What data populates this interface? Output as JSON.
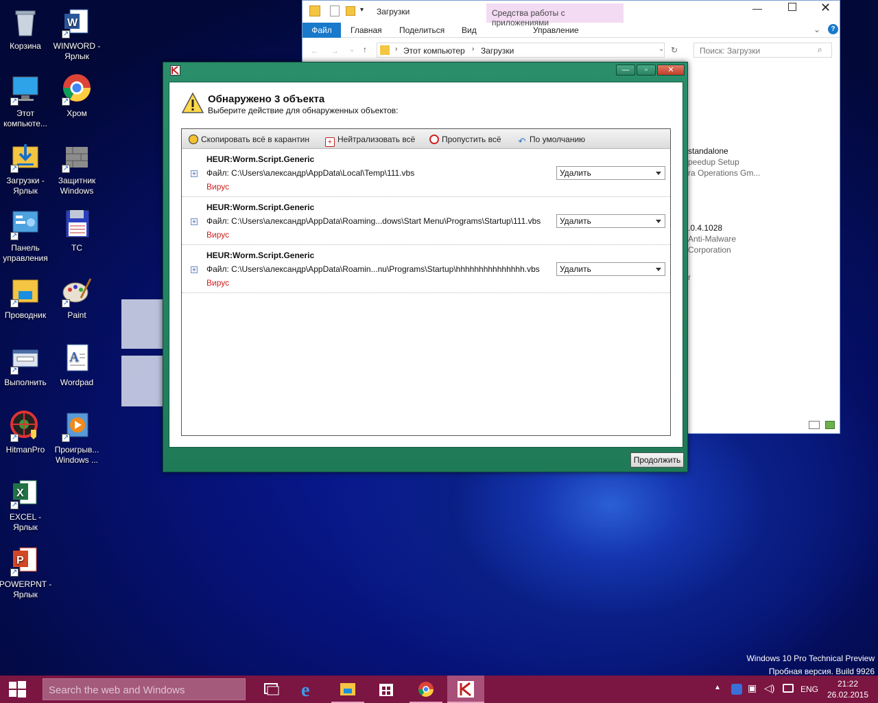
{
  "desktop": {
    "icons": [
      {
        "label": "Корзина"
      },
      {
        "label": "WINWORD - Ярлык"
      },
      {
        "label": "Этот компьюте..."
      },
      {
        "label": "Хром"
      },
      {
        "label": "Загрузки - Ярлык"
      },
      {
        "label": "Защитник Windows"
      },
      {
        "label": "Панель управления"
      },
      {
        "label": "TC"
      },
      {
        "label": "Проводник"
      },
      {
        "label": "Paint"
      },
      {
        "label": "Выполнить"
      },
      {
        "label": "Wordpad"
      },
      {
        "label": "HitmanPro"
      },
      {
        "label": "Проигрыв... Windows ..."
      },
      {
        "label": "EXCEL - Ярлык"
      },
      {
        "label": "POWERPNT - Ярлык"
      }
    ],
    "watermark": {
      "line1": "Windows 10 Pro Technical Preview",
      "line2": "Пробная версия. Build 9926"
    }
  },
  "explorer": {
    "title": "Загрузки",
    "context_tab": "Средства работы с приложениями",
    "tabs": {
      "file": "Файл",
      "home": "Главная",
      "share": "Поделиться",
      "view": "Вид",
      "manage": "Управление"
    },
    "breadcrumb": [
      "Этот компьютер",
      "Загрузки"
    ],
    "search_placeholder": "Поиск: Загрузки",
    "visible_fragments": [
      "standalone",
      "peedup Setup",
      "ra Operations Gm...",
      ".0.4.1028",
      "Anti-Malware",
      "Corporation",
      "r"
    ]
  },
  "kav": {
    "heading": "Обнаружено 3 объекта",
    "subheading": "Выберите действие для обнаруженных объектов:",
    "toolbar": {
      "quarantine": "Скопировать всё в карантин",
      "neutralize": "Нейтрализовать всё",
      "skip": "Пропустить всё",
      "default": "По умолчанию"
    },
    "items": [
      {
        "name": "HEUR:Worm.Script.Generic",
        "file": "Файл: C:\\Users\\александр\\AppData\\Local\\Temp\\111.vbs",
        "type": "Вирус",
        "action": "Удалить"
      },
      {
        "name": "HEUR:Worm.Script.Generic",
        "file": "Файл: C:\\Users\\александр\\AppData\\Roaming...dows\\Start Menu\\Programs\\Startup\\111.vbs",
        "type": "Вирус",
        "action": "Удалить"
      },
      {
        "name": "HEUR:Worm.Script.Generic",
        "file": "Файл: C:\\Users\\александр\\AppData\\Roamin...nu\\Programs\\Startup\\hhhhhhhhhhhhhhh.vbs",
        "type": "Вирус",
        "action": "Удалить"
      }
    ],
    "continue_label": "Продолжить"
  },
  "taskbar": {
    "search_placeholder": "Search the web and Windows",
    "language": "ENG",
    "time": "21:22",
    "date": "26.02.2015"
  },
  "colors": {
    "kav_green": "#2b8e6b",
    "taskbar": "#7b1542",
    "virus_red": "#d02020",
    "ribbon_file": "#1979ca"
  }
}
